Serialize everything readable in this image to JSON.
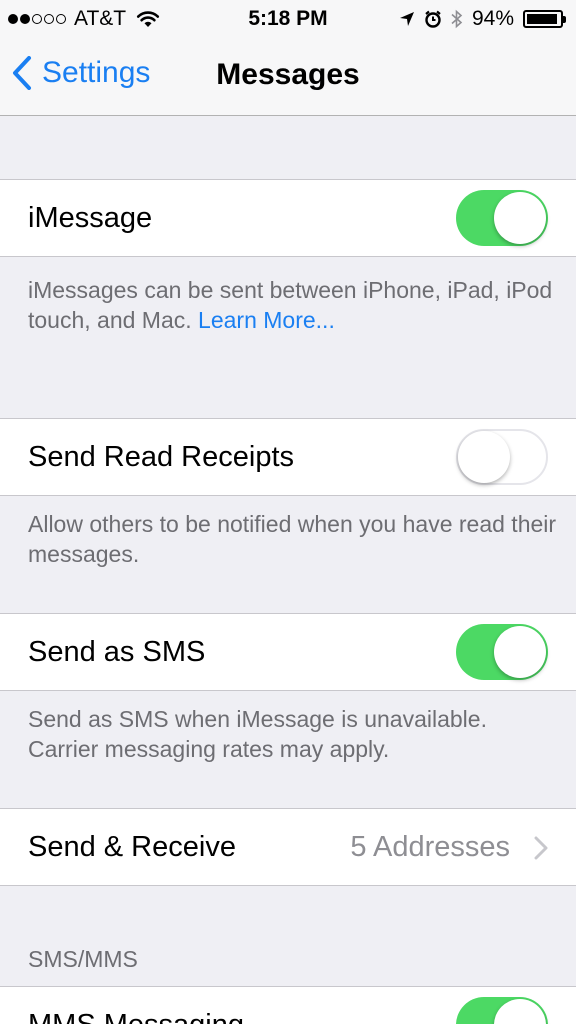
{
  "status": {
    "signal_bars_filled": 2,
    "signal_bars_total": 5,
    "carrier": "AT&T",
    "time": "5:18 PM",
    "battery": "94%",
    "battery_level": 0.94,
    "icons": [
      "wifi-icon",
      "location-icon",
      "alarm-icon",
      "bluetooth-icon",
      "battery-icon"
    ]
  },
  "nav": {
    "back_label": "Settings",
    "title": "Messages"
  },
  "imessage": {
    "label": "iMessage",
    "enabled": true,
    "footer": "iMessages can be sent between iPhone, iPad, iPod touch, and Mac.",
    "footer_link": "Learn More..."
  },
  "read_receipts": {
    "label": "Send Read Receipts",
    "enabled": false,
    "footer": "Allow others to be notified when you have read their messages."
  },
  "send_as_sms": {
    "label": "Send as SMS",
    "enabled": true,
    "footer": "Send as SMS when iMessage is unavailable. Carrier messaging rates may apply."
  },
  "send_receive": {
    "label": "Send & Receive",
    "detail": "5 Addresses"
  },
  "sms_mms": {
    "header": "SMS/MMS",
    "mms_label": "MMS Messaging",
    "mms_enabled": true
  },
  "colors": {
    "accent": "#1a7ff2",
    "switch_on": "#4cd964",
    "background": "#efeff4",
    "footer_text": "#6d6d72"
  }
}
